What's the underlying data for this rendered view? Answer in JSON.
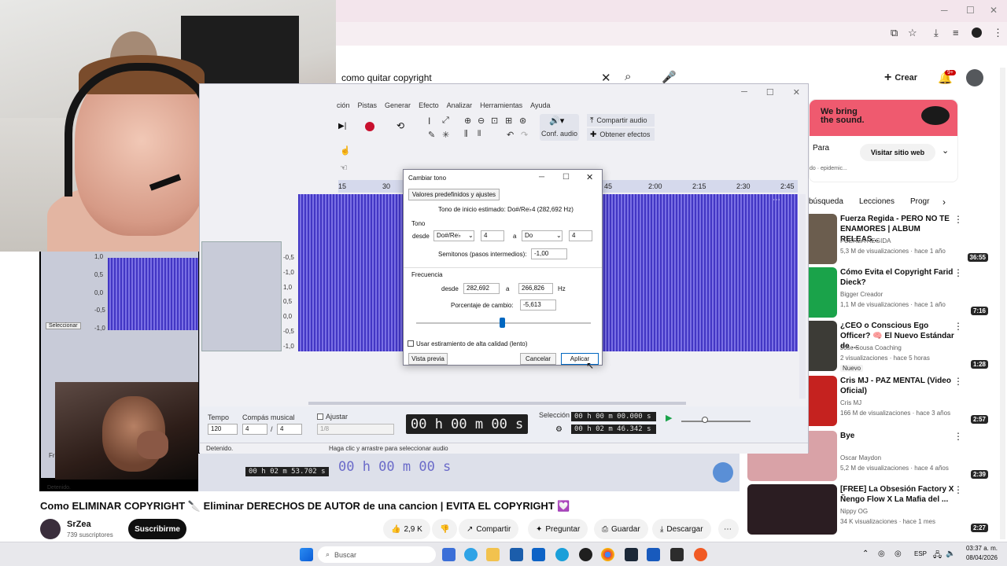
{
  "browser": {
    "min_icon": "─",
    "max_icon": "☐",
    "close_icon": "✕"
  },
  "youtube": {
    "search_query": "como quitar copyright",
    "create_label": "Crear",
    "notif_count": "9+",
    "ad": {
      "headline_1": "We bring",
      "headline_2": "the sound.",
      "title": "Para",
      "sub": "do · epidemic...",
      "cta": "Visitar sitio web"
    },
    "chips": [
      "búsqueda",
      "Lecciones",
      "Progr"
    ],
    "video_title": "Como ELIMINAR COPYRIGHT 🔪 Eliminar DERECHOS DE AUTOR de una cancion | EVITA EL COPYRIGHT 💟",
    "channel_name": "SrZea",
    "subscribers": "739 suscriptores",
    "subscribe_label": "Suscribirme",
    "likes": "2,9 K",
    "share_label": "Compartir",
    "ask_label": "Preguntar",
    "save_label": "Guardar",
    "download_label": "Descargar",
    "recommendations": [
      {
        "title": "Fuerza Regida - PERO NO TE ENAMORES | ALBUM RELEAS...",
        "channel": "FUERZA REGIDA",
        "meta": "5,3 M de visualizaciones · hace 1 año",
        "duration": "36:55",
        "thumb_color": "#6b5d4e"
      },
      {
        "title": "Cómo Evita el Copyright Farid Dieck?",
        "channel": "Bigger Creador",
        "meta": "1,1 M de visualizaciones · hace 1 año",
        "duration": "7:16",
        "thumb_color": "#1aa34a"
      },
      {
        "title": "¿CEO o Conscious Ego Officer? 🧠 El Nuevo Estándar de ...",
        "channel": "Jose Sousa Coaching",
        "meta": "2 visualizaciones · hace 5 horas",
        "badge": "Nuevo",
        "duration": "1:28",
        "thumb_color": "#3c3b36"
      },
      {
        "title": "Cris MJ - PAZ MENTAL (Video Oficial)",
        "channel": "Cris MJ",
        "meta": "166 M de visualizaciones · hace 3 años",
        "duration": "2:57",
        "thumb_color": "#c5221f"
      },
      {
        "title": "Bye",
        "channel": "Oscar Maydon",
        "meta": "5,2 M de visualizaciones · hace 4 años",
        "duration": "2:39",
        "thumb_color": "#d9a2a7"
      },
      {
        "title": "[FREE] La Obsesión Factory X Ñengo Flow X La Mafia del ...",
        "channel": "Nippy OG",
        "meta": "34 K visualizaciones · hace 1 mes",
        "duration": "2:27",
        "thumb_color": "#2b1d22"
      }
    ]
  },
  "audacity": {
    "menu": [
      "ción",
      "Pistas",
      "Generar",
      "Efecto",
      "Analizar",
      "Herramientas",
      "Ayuda"
    ],
    "share_audio": "Compartir audio",
    "get_effects": "Obtener efectos",
    "audio_setup": "Conf. audio",
    "timeline": [
      "15",
      "30",
      "45",
      "2:00",
      "2:15",
      "2:30",
      "2:45"
    ],
    "scale_top": [
      "1,0",
      "0,5",
      "0,0",
      "-0,5",
      "-1,0"
    ],
    "scale_left": [
      "-0,5",
      "-1,0",
      "1,0",
      "0,5",
      "0,0",
      "-0,5",
      "-1,0"
    ],
    "select_btn": "Seleccionar",
    "tempo_label": "Tempo",
    "tempo_value": "120",
    "meter_label": "Compás musical",
    "meter_num": "4",
    "meter_den": "4",
    "snap_label": "Ajustar",
    "snap_value": "1/8",
    "time_display": "00 h 00 m 00 s",
    "selection_label": "Selección",
    "sel_start": "00 h 00 m 00.000 s",
    "sel_end": "00 h 02 m 46.342 s",
    "status_left": "Detenido.",
    "status_mid": "Haga clic y arrastre para seleccionar audio",
    "behind_time": "00 h 00 m 00 s",
    "behind_small": "00 h 02 m 53.702 s",
    "behind_status": "Detenido.",
    "behind_fr": "Fr"
  },
  "dialog": {
    "title": "Cambiar tono",
    "presets": "Valores predefinidos y ajustes",
    "estimated": "Tono de inicio estimado: Do#/Re♭4 (282,692 Hz)",
    "pitch_section": "Tono",
    "from_label": "desde",
    "from_note": "Do#/Re♭",
    "from_octave": "4",
    "to_label": "a",
    "to_note": "Do",
    "to_octave": "4",
    "semitones_label": "Semitonos (pasos intermedios):",
    "semitones_value": "-1,00",
    "freq_section": "Frecuencia",
    "freq_from_label": "desde",
    "freq_from": "282,692",
    "freq_to_label": "a",
    "freq_to": "266,826",
    "hz": "Hz",
    "percent_label": "Porcentaje de cambio:",
    "percent_value": "-5,613",
    "slider_level": 0.49,
    "hq_label": "Usar estiramiento de alta calidad (lento)",
    "preview": "Vista previa",
    "cancel": "Cancelar",
    "apply": "Aplicar"
  },
  "taskbar": {
    "search_placeholder": "Buscar",
    "lang": "ESP",
    "time": "03:37 a. m.",
    "date": "08/04/2026"
  }
}
